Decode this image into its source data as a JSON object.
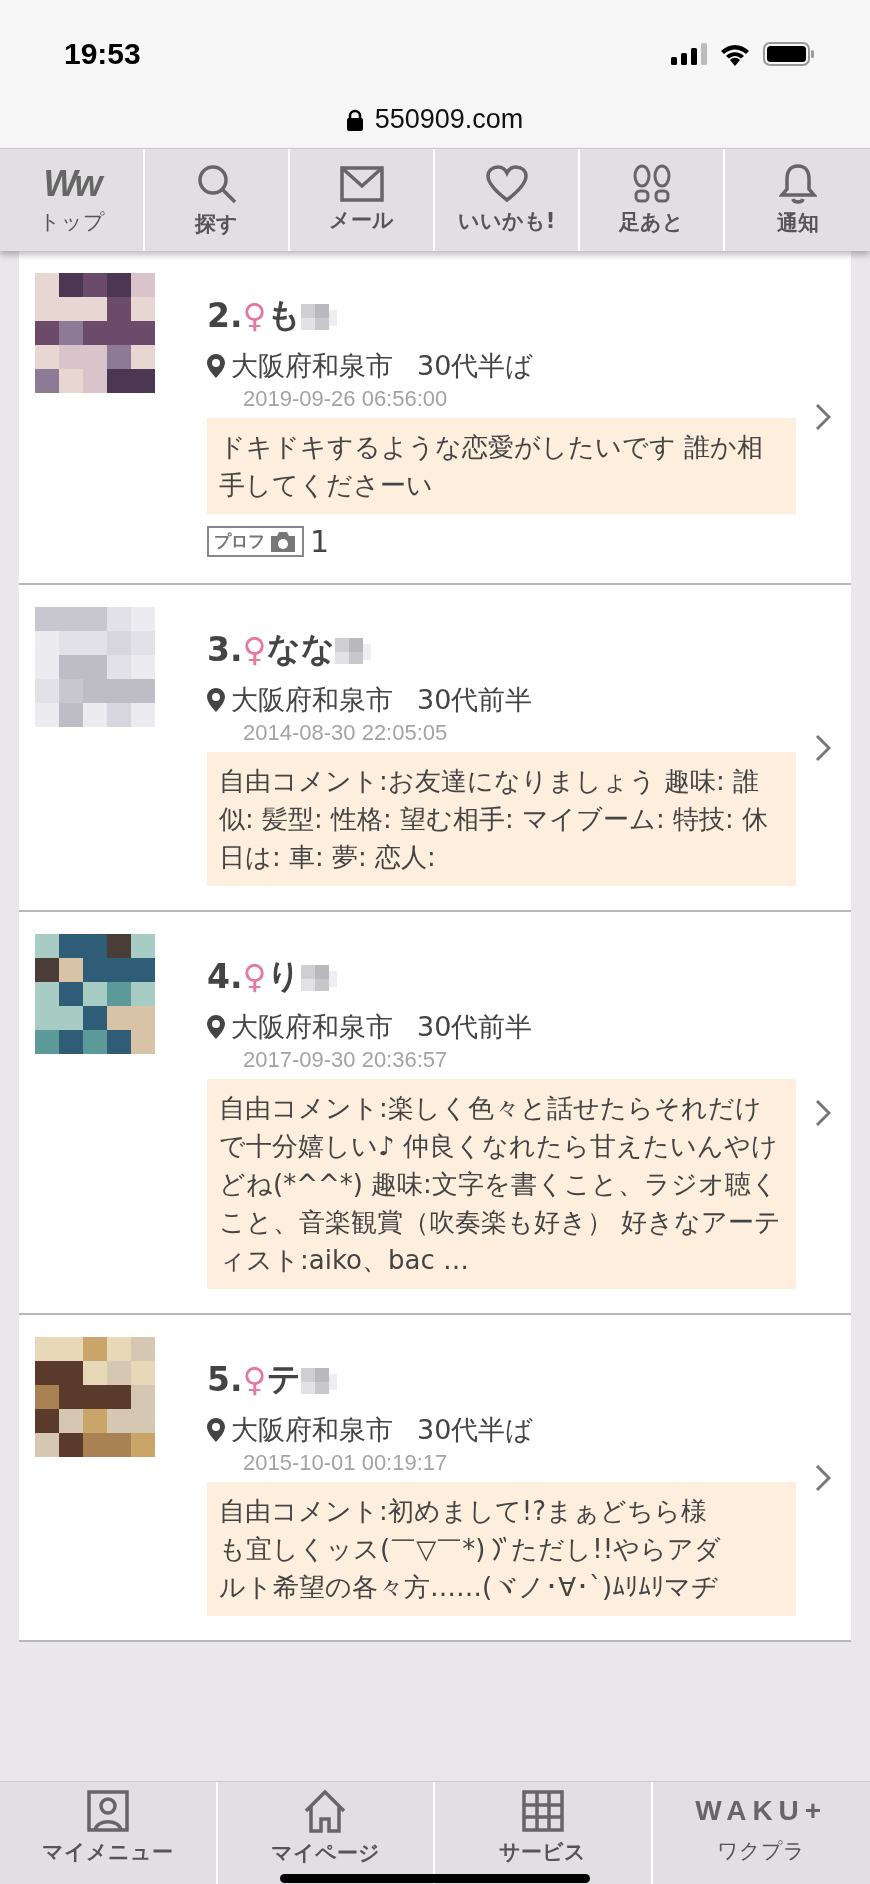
{
  "status_bar": {
    "time": "19:53",
    "url": "550909.com"
  },
  "top_nav": [
    {
      "kind": "logo",
      "logo": "Ww",
      "label": "トップ"
    },
    {
      "kind": "search",
      "label": "探す"
    },
    {
      "kind": "mail",
      "label": "メール"
    },
    {
      "kind": "heart",
      "label": "いいかも!"
    },
    {
      "kind": "footprints",
      "label": "足あと"
    },
    {
      "kind": "bell",
      "label": "通知"
    }
  ],
  "profiles": [
    {
      "rank": "2.",
      "gender": "♀",
      "name": "も",
      "location": "大阪府和泉市",
      "age": "30代半ば",
      "date": "2019-09-26 06:56:00",
      "comment": "ドキドキするような恋愛がしたいです 誰か相手してくださーい",
      "photo_badge": {
        "label": "プロフ",
        "count": "1"
      }
    },
    {
      "rank": "3.",
      "gender": "♀",
      "name": "なな",
      "location": "大阪府和泉市",
      "age": "30代前半",
      "date": "2014-08-30 22:05:05",
      "comment": "自由コメント:お友達になりましょう 趣味: 誰似: 髪型: 性格: 望む相手: マイブーム: 特技: 休日は: 車: 夢: 恋人:"
    },
    {
      "rank": "4.",
      "gender": "♀",
      "name": "り",
      "location": "大阪府和泉市",
      "age": "30代前半",
      "date": "2017-09-30 20:36:57",
      "comment": "自由コメント:楽しく色々と話せたらそれだけで十分嬉しい♪ 仲良くなれたら甘えたいんやけどね(*^^*) 趣味:文字を書くこと、ラジオ聴くこと、音楽観賞（吹奏楽も好き） 好きなアーティスト:aiko、bac …"
    },
    {
      "rank": "5.",
      "gender": "♀",
      "name": "テ",
      "location": "大阪府和泉市",
      "age": "30代半ば",
      "date": "2015-10-01 00:19:17",
      "comment": [
        [
          {
            "kind": "text",
            "text": "自由コメント:初めまして!?まぁどちら様"
          }
        ],
        [
          {
            "kind": "text",
            "text": "も宜しくッス(￣▽￣*)"
          },
          {
            "kind": "iteration-mark"
          },
          {
            "kind": "text",
            "text": "ただし!!やらアダ"
          }
        ],
        [
          {
            "kind": "text",
            "text": "ルト希望の各々方……(ヾノ･∀･`)ﾑﾘﾑﾘマヂ"
          }
        ]
      ]
    }
  ],
  "bottom_nav": [
    {
      "kind": "person",
      "label": "マイメニュー"
    },
    {
      "kind": "home",
      "label": "マイページ"
    },
    {
      "kind": "grid",
      "label": "サービス"
    },
    {
      "kind": "logo",
      "logo": "WAKU+",
      "label": "ワクプラ"
    }
  ]
}
